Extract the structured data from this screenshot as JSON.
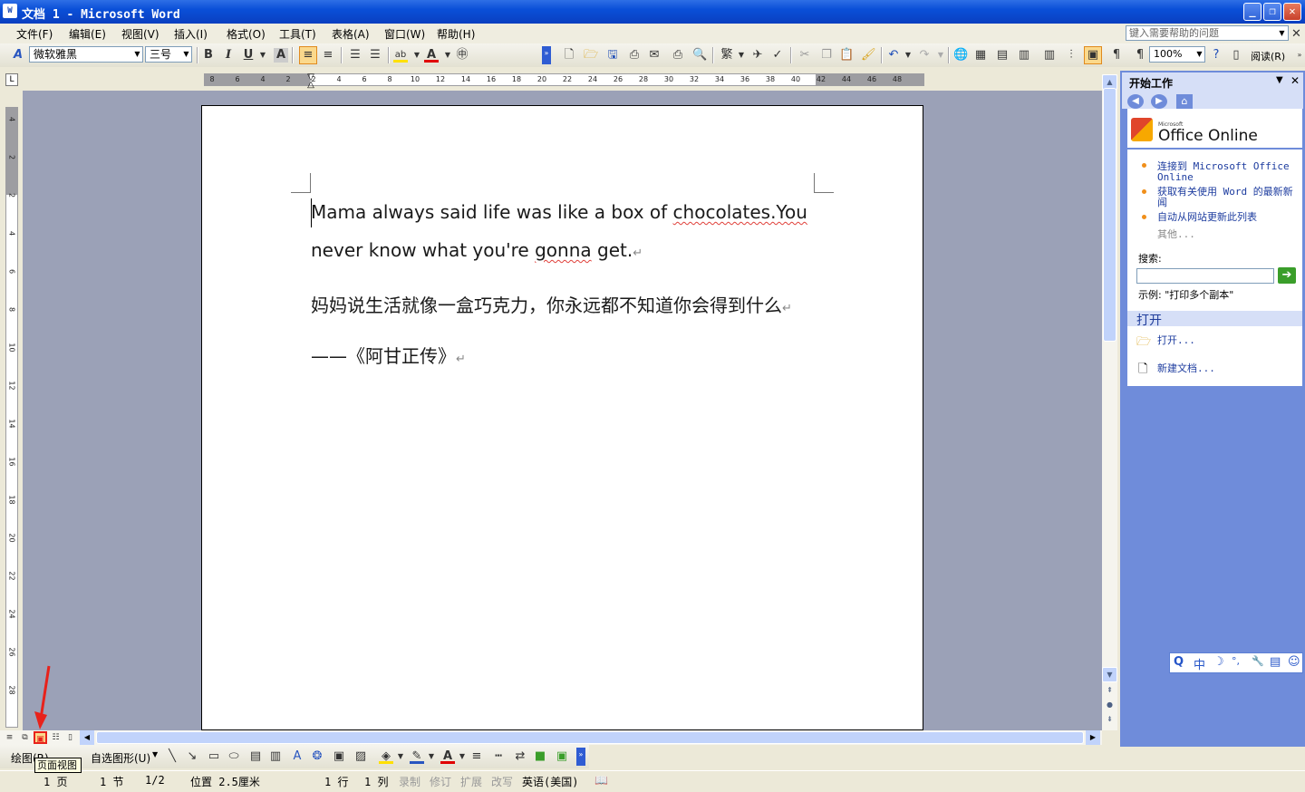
{
  "titlebar": {
    "title": "文档 1 - Microsoft Word",
    "app_icon": "W",
    "min": "_",
    "restore": "❐",
    "close": "✕"
  },
  "menubar": {
    "items": [
      "文件(F)",
      "编辑(E)",
      "视图(V)",
      "插入(I)",
      "格式(O)",
      "工具(T)",
      "表格(A)",
      "窗口(W)",
      "帮助(H)"
    ],
    "help_placeholder": "键入需要帮助的问题",
    "close_doc": "✕"
  },
  "format_toolbar": {
    "font": "微软雅黑",
    "size": "三号",
    "zoom": "100%",
    "read_label": "阅读(R)"
  },
  "ruler": {
    "h_ticks": [
      "8",
      "6",
      "4",
      "2",
      "2",
      "4",
      "6",
      "8",
      "10",
      "12",
      "14",
      "16",
      "18",
      "20",
      "22",
      "24",
      "26",
      "28",
      "30",
      "32",
      "34",
      "36",
      "38",
      "40",
      "42",
      "44",
      "46",
      "48"
    ],
    "v_ticks": [
      "4",
      "2",
      "2",
      "4",
      "6",
      "8",
      "10",
      "12",
      "14",
      "16",
      "18",
      "20",
      "22",
      "24",
      "26",
      "28"
    ]
  },
  "document": {
    "line1_a": "Mama always said life was like a box of ",
    "line1_b": "chocolates.You",
    "line2_a": "never know what you're ",
    "line2_b": "gonna",
    "line2_c": " get.",
    "para3": "妈妈说生活就像一盒巧克力，你永远都不知道你会得到什么",
    "para4": "——《阿甘正传》",
    "para_mark": "↵"
  },
  "taskpane": {
    "title": "开始工作",
    "office_small": "Microsoft",
    "office_online": "Office Online",
    "links": [
      "连接到 Microsoft Office Online",
      "获取有关使用 Word 的最新新闻",
      "自动从网站更新此列表"
    ],
    "more": "其他...",
    "search_label": "搜索:",
    "example": "示例:  \"打印多个副本\"",
    "open_header": "打开",
    "open_link": "打开...",
    "new_doc_link": "新建文档..."
  },
  "ime": {
    "items": [
      "Q",
      "中",
      "☽",
      "°,",
      "🔧",
      "▤",
      "☺"
    ]
  },
  "drawing_toolbar": {
    "draw_label": "绘图(R)",
    "autoshapes_label": "自选图形(U)"
  },
  "tooltip": {
    "text": "页面视图"
  },
  "statusbar": {
    "page": "1 页",
    "section": "1 节",
    "pages": "1/2",
    "position": "位置 2.5厘米",
    "line": "1 行",
    "col": "1 列",
    "rec": "录制",
    "trk": "修订",
    "ext": "扩展",
    "ovr": "改写",
    "language": "英语(美国)"
  },
  "colors": {
    "title_blue": "#0A4FD8",
    "page_bg": "#9BA1B7",
    "taskpane_blue": "#6F8CDA",
    "squiggle": "#e0403a",
    "annotation_red": "#E8221B"
  }
}
